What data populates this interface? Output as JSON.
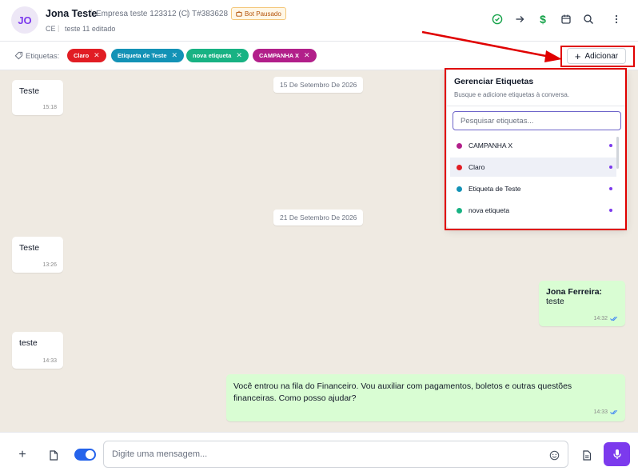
{
  "header": {
    "avatar_initials": "JO",
    "contact_name": "Jona Teste",
    "company": "Empresa teste 123312 (C)",
    "ticket": "T#383628",
    "bot_status": "Bot Pausado",
    "state": "CE",
    "subtitle": "teste 11 editado",
    "icons": [
      "check-circle-icon",
      "arrow-right-icon",
      "dollar-icon",
      "calendar-icon",
      "search-icon",
      "more-vertical-icon"
    ]
  },
  "tags_bar": {
    "label": "Etiquetas:",
    "tags": [
      {
        "name": "Claro",
        "color": "#e11d24"
      },
      {
        "name": "Etiqueta de Teste",
        "color": "#1392b6"
      },
      {
        "name": "nova etiqueta",
        "color": "#18b283"
      },
      {
        "name": "CAMPANHA X",
        "color": "#b21f8a"
      }
    ],
    "add_label": "Adicionar"
  },
  "tag_manager": {
    "title": "Gerenciar Etiquetas",
    "subtitle": "Busque e adicione etiquetas à conversa.",
    "search_placeholder": "Pesquisar etiquetas...",
    "items": [
      {
        "name": "CAMPANHA X",
        "color": "#b21f8a",
        "selected": true
      },
      {
        "name": "Claro",
        "color": "#e11d24",
        "selected": true,
        "highlighted": true
      },
      {
        "name": "Etiqueta de Teste",
        "color": "#1392b6",
        "selected": true
      },
      {
        "name": "nova etiqueta",
        "color": "#18b283",
        "selected": true
      }
    ]
  },
  "chat": {
    "dates": [
      "15 De Setembro De 2026",
      "21 De Setembro De 2026"
    ],
    "messages": [
      {
        "direction": "in",
        "text": "Teste",
        "time": "15:18"
      },
      {
        "direction": "in",
        "text": "Teste",
        "time": "13:26"
      },
      {
        "direction": "out",
        "author": "Jona Ferreira:",
        "text": "teste",
        "time": "14:32",
        "read": true
      },
      {
        "direction": "in",
        "text": "teste",
        "time": "14:33"
      },
      {
        "direction": "out",
        "text": "Você entrou na fila do Financeiro. Vou auxiliar com pagamentos, boletos e outras questões financeiras. Como posso ajudar?",
        "time": "14:33",
        "read": true
      }
    ]
  },
  "composer": {
    "placeholder": "Digite uma mensagem...",
    "toggle_on": true
  },
  "colors": {
    "accent": "#7c3aed",
    "highlight_box": "#e00000",
    "chat_background": "#efeae2",
    "outgoing_bubble": "#d9fdd3"
  }
}
